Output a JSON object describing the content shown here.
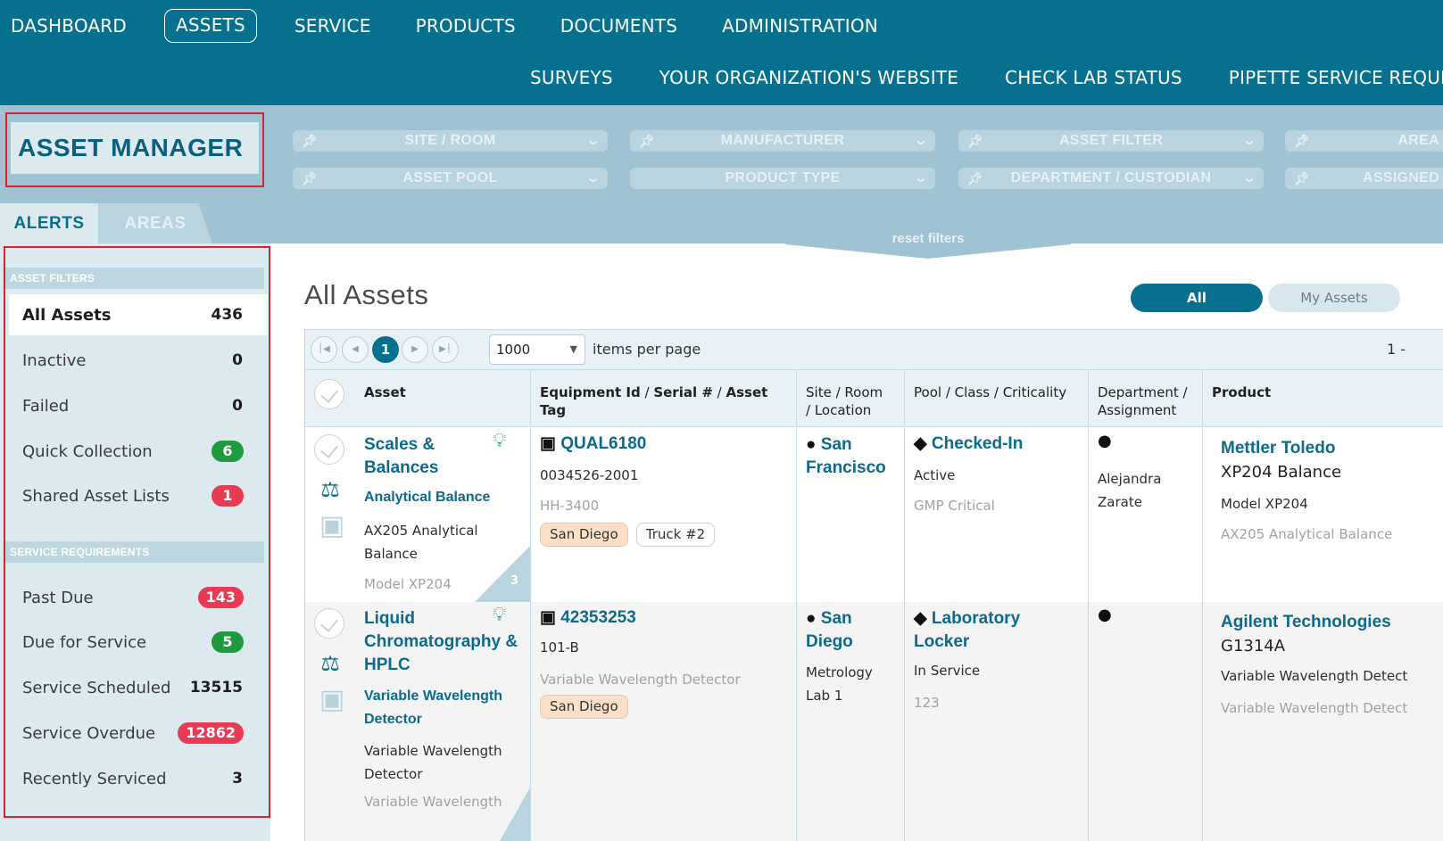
{
  "nav": {
    "primary": [
      "DASHBOARD",
      "ASSETS",
      "SERVICE",
      "PRODUCTS",
      "DOCUMENTS",
      "ADMINISTRATION"
    ],
    "active": "ASSETS",
    "secondary": [
      "SURVEYS",
      "YOUR ORGANIZATION'S WEBSITE",
      "CHECK LAB STATUS",
      "PIPETTE SERVICE REQUE"
    ]
  },
  "header": {
    "title": "ASSET MANAGER"
  },
  "filters": {
    "row1": [
      "SITE / ROOM",
      "MANUFACTURER",
      "ASSET FILTER",
      "AREA"
    ],
    "row2": [
      "ASSET POOL",
      "PRODUCT TYPE",
      "DEPARTMENT / CUSTODIAN",
      "ASSIGNED"
    ],
    "reset_label": "reset filters"
  },
  "tabs": {
    "alerts": "ALERTS",
    "areas": "AREAS"
  },
  "sidebar": {
    "asset_filters_header": "ASSET FILTERS",
    "asset_filters": [
      {
        "label": "All Assets",
        "count": "436",
        "style": "plain"
      },
      {
        "label": "Inactive",
        "count": "0",
        "style": "plain"
      },
      {
        "label": "Failed",
        "count": "0",
        "style": "plain"
      },
      {
        "label": "Quick Collection",
        "count": "6",
        "style": "green"
      },
      {
        "label": "Shared Asset Lists",
        "count": "1",
        "style": "red"
      }
    ],
    "service_header": "SERVICE REQUIREMENTS",
    "service": [
      {
        "label": "Past Due",
        "count": "143",
        "style": "red"
      },
      {
        "label": "Due for Service",
        "count": "5",
        "style": "green"
      },
      {
        "label": "Service Scheduled",
        "count": "13515",
        "style": "plain"
      },
      {
        "label": "Service Overdue",
        "count": "12862",
        "style": "red"
      },
      {
        "label": "Recently Serviced",
        "count": "3",
        "style": "plain"
      }
    ]
  },
  "main": {
    "title": "All Assets",
    "toggle_all": "All",
    "toggle_my": "My Assets",
    "pager": {
      "current_page": "1",
      "items_per_page": "1000",
      "items_per_page_label": "items per page",
      "range": "1 -"
    },
    "columns": {
      "asset": "Asset",
      "equipment_id": "Equipment Id",
      "serial": "Serial #",
      "asset_tag": "Asset Tag",
      "site_room": "Site / Room",
      "location": "/ Location",
      "pool": "Pool",
      "class": "Class",
      "criticality": "Criticality",
      "department": "Department /",
      "assignment": "Assignment",
      "product": "Product"
    },
    "rows": [
      {
        "asset_title_line1": "Scales &",
        "asset_title_line2": "Balances",
        "asset_subtitle": "Analytical Balance",
        "asset_desc_line1": "AX205 Analytical",
        "asset_desc_line2": "Balance",
        "asset_model": "Model XP204",
        "corner_count": "3",
        "equipment_id": "QUAL6180",
        "serial": "0034526-2001",
        "asset_tag": "HH-3400",
        "tags": [
          "San Diego",
          "Truck #2"
        ],
        "site_line1": "San",
        "site_line2": "Francisco",
        "pool": "Checked-In",
        "class": "Active",
        "criticality": "GMP Critical",
        "person_line1": "Alejandra",
        "person_line2": "Zarate",
        "product_maker": "Mettler Toledo",
        "product_name": "XP204 Balance",
        "product_model": "Model XP204",
        "product_desc": "AX205 Analytical Balance"
      },
      {
        "asset_title_line1": "Liquid",
        "asset_title_line2": "Chromatography &",
        "asset_title_line3": "HPLC",
        "asset_subtitle_line1": "Variable Wavelength",
        "asset_subtitle_line2": "Detector",
        "asset_desc_line1": "Variable Wavelength",
        "asset_desc_line2": "Detector",
        "asset_model": "Variable Wavelength",
        "equipment_id": "42353253",
        "serial": "101-B",
        "asset_tag": "Variable Wavelength Detector",
        "tags": [
          "San Diego"
        ],
        "site_line1": "San",
        "site_line2": "Diego",
        "site_room_line1": "Metrology",
        "site_room_line2": "Lab 1",
        "pool_line1": "Laboratory",
        "pool_line2": "Locker",
        "class": "In Service",
        "criticality": "123",
        "product_maker": "Agilent Technologies",
        "product_name": "G1314A",
        "product_model": "Variable Wavelength Detect",
        "product_desc": "Variable Wavelength Detect"
      }
    ]
  },
  "colors": {
    "nav_bg": "#06708f",
    "filter_band": "#9fc3d2",
    "link": "#0b6a8d",
    "badge_green": "#1f9a3e",
    "badge_red": "#e73a53",
    "highlight_box": "#e02030"
  }
}
